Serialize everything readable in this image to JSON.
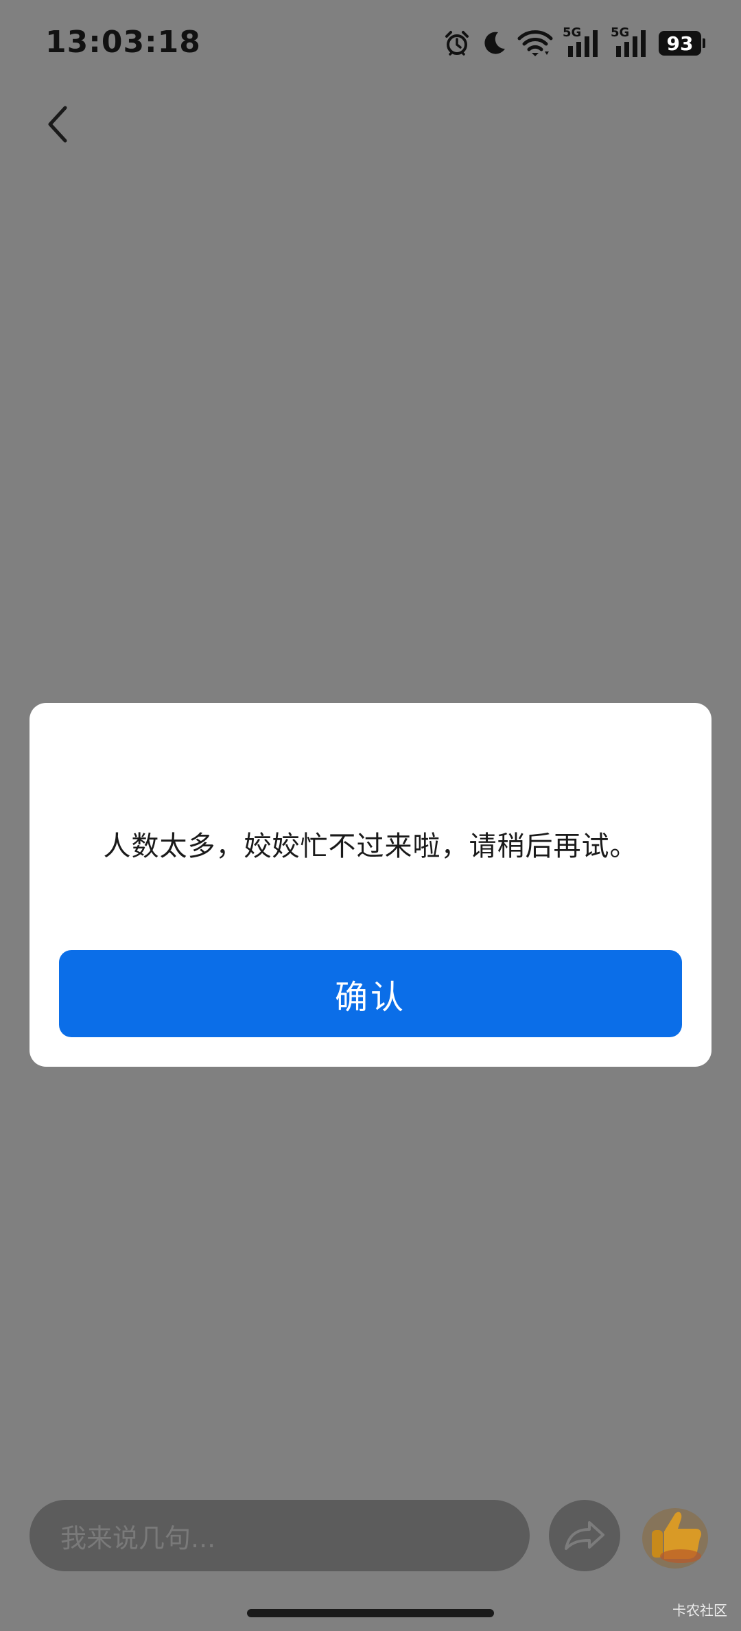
{
  "status_bar": {
    "time": "13:03:18",
    "network_1": "5G",
    "network_2": "5G",
    "battery": "93",
    "icons": [
      "alarm-icon",
      "moon-icon",
      "wifi-icon",
      "signal-5g-icon",
      "signal-5g-icon",
      "battery-icon"
    ]
  },
  "header": {
    "back_icon": "chevron-left-icon"
  },
  "dialog": {
    "message": "人数太多，姣姣忙不过来啦，请稍后再试。",
    "confirm_label": "确认",
    "accent_color": "#0b6ee8"
  },
  "bottom_bar": {
    "comment_placeholder": "我来说几句...",
    "share_icon": "share-icon",
    "like_icon": "thumbs-up-icon"
  },
  "watermark": "卡农社区"
}
